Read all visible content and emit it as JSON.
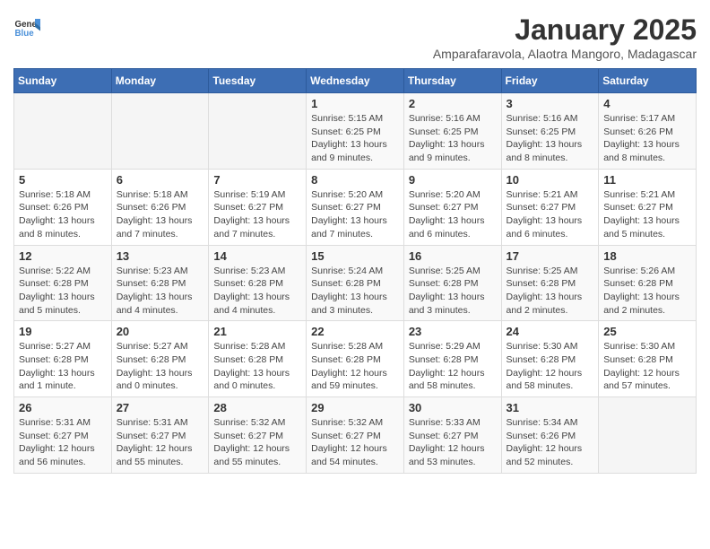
{
  "header": {
    "logo_general": "General",
    "logo_blue": "Blue",
    "month_year": "January 2025",
    "location": "Amparafaravola, Alaotra Mangoro, Madagascar"
  },
  "days_of_week": [
    "Sunday",
    "Monday",
    "Tuesday",
    "Wednesday",
    "Thursday",
    "Friday",
    "Saturday"
  ],
  "weeks": [
    [
      {
        "day": "",
        "info": ""
      },
      {
        "day": "",
        "info": ""
      },
      {
        "day": "",
        "info": ""
      },
      {
        "day": "1",
        "info": "Sunrise: 5:15 AM\nSunset: 6:25 PM\nDaylight: 13 hours and 9 minutes."
      },
      {
        "day": "2",
        "info": "Sunrise: 5:16 AM\nSunset: 6:25 PM\nDaylight: 13 hours and 9 minutes."
      },
      {
        "day": "3",
        "info": "Sunrise: 5:16 AM\nSunset: 6:25 PM\nDaylight: 13 hours and 8 minutes."
      },
      {
        "day": "4",
        "info": "Sunrise: 5:17 AM\nSunset: 6:26 PM\nDaylight: 13 hours and 8 minutes."
      }
    ],
    [
      {
        "day": "5",
        "info": "Sunrise: 5:18 AM\nSunset: 6:26 PM\nDaylight: 13 hours and 8 minutes."
      },
      {
        "day": "6",
        "info": "Sunrise: 5:18 AM\nSunset: 6:26 PM\nDaylight: 13 hours and 7 minutes."
      },
      {
        "day": "7",
        "info": "Sunrise: 5:19 AM\nSunset: 6:27 PM\nDaylight: 13 hours and 7 minutes."
      },
      {
        "day": "8",
        "info": "Sunrise: 5:20 AM\nSunset: 6:27 PM\nDaylight: 13 hours and 7 minutes."
      },
      {
        "day": "9",
        "info": "Sunrise: 5:20 AM\nSunset: 6:27 PM\nDaylight: 13 hours and 6 minutes."
      },
      {
        "day": "10",
        "info": "Sunrise: 5:21 AM\nSunset: 6:27 PM\nDaylight: 13 hours and 6 minutes."
      },
      {
        "day": "11",
        "info": "Sunrise: 5:21 AM\nSunset: 6:27 PM\nDaylight: 13 hours and 5 minutes."
      }
    ],
    [
      {
        "day": "12",
        "info": "Sunrise: 5:22 AM\nSunset: 6:28 PM\nDaylight: 13 hours and 5 minutes."
      },
      {
        "day": "13",
        "info": "Sunrise: 5:23 AM\nSunset: 6:28 PM\nDaylight: 13 hours and 4 minutes."
      },
      {
        "day": "14",
        "info": "Sunrise: 5:23 AM\nSunset: 6:28 PM\nDaylight: 13 hours and 4 minutes."
      },
      {
        "day": "15",
        "info": "Sunrise: 5:24 AM\nSunset: 6:28 PM\nDaylight: 13 hours and 3 minutes."
      },
      {
        "day": "16",
        "info": "Sunrise: 5:25 AM\nSunset: 6:28 PM\nDaylight: 13 hours and 3 minutes."
      },
      {
        "day": "17",
        "info": "Sunrise: 5:25 AM\nSunset: 6:28 PM\nDaylight: 13 hours and 2 minutes."
      },
      {
        "day": "18",
        "info": "Sunrise: 5:26 AM\nSunset: 6:28 PM\nDaylight: 13 hours and 2 minutes."
      }
    ],
    [
      {
        "day": "19",
        "info": "Sunrise: 5:27 AM\nSunset: 6:28 PM\nDaylight: 13 hours and 1 minute."
      },
      {
        "day": "20",
        "info": "Sunrise: 5:27 AM\nSunset: 6:28 PM\nDaylight: 13 hours and 0 minutes."
      },
      {
        "day": "21",
        "info": "Sunrise: 5:28 AM\nSunset: 6:28 PM\nDaylight: 13 hours and 0 minutes."
      },
      {
        "day": "22",
        "info": "Sunrise: 5:28 AM\nSunset: 6:28 PM\nDaylight: 12 hours and 59 minutes."
      },
      {
        "day": "23",
        "info": "Sunrise: 5:29 AM\nSunset: 6:28 PM\nDaylight: 12 hours and 58 minutes."
      },
      {
        "day": "24",
        "info": "Sunrise: 5:30 AM\nSunset: 6:28 PM\nDaylight: 12 hours and 58 minutes."
      },
      {
        "day": "25",
        "info": "Sunrise: 5:30 AM\nSunset: 6:28 PM\nDaylight: 12 hours and 57 minutes."
      }
    ],
    [
      {
        "day": "26",
        "info": "Sunrise: 5:31 AM\nSunset: 6:27 PM\nDaylight: 12 hours and 56 minutes."
      },
      {
        "day": "27",
        "info": "Sunrise: 5:31 AM\nSunset: 6:27 PM\nDaylight: 12 hours and 55 minutes."
      },
      {
        "day": "28",
        "info": "Sunrise: 5:32 AM\nSunset: 6:27 PM\nDaylight: 12 hours and 55 minutes."
      },
      {
        "day": "29",
        "info": "Sunrise: 5:32 AM\nSunset: 6:27 PM\nDaylight: 12 hours and 54 minutes."
      },
      {
        "day": "30",
        "info": "Sunrise: 5:33 AM\nSunset: 6:27 PM\nDaylight: 12 hours and 53 minutes."
      },
      {
        "day": "31",
        "info": "Sunrise: 5:34 AM\nSunset: 6:26 PM\nDaylight: 12 hours and 52 minutes."
      },
      {
        "day": "",
        "info": ""
      }
    ]
  ]
}
